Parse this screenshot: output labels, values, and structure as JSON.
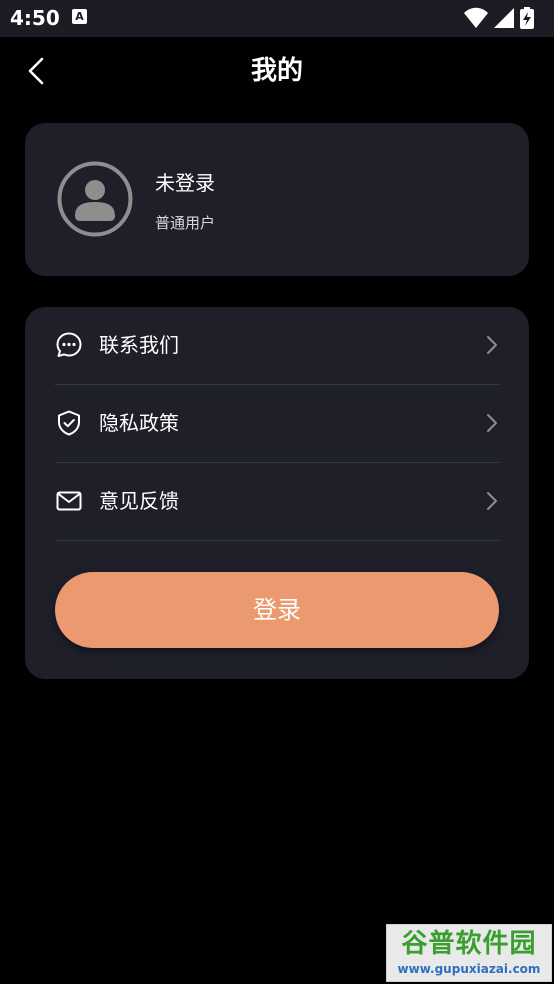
{
  "status_bar": {
    "time": "4:50",
    "a_icon_letter": "A",
    "icons": [
      "wifi-icon",
      "signal-icon",
      "battery-icon"
    ]
  },
  "header": {
    "title": "我的",
    "back_icon": "chevron-left-icon"
  },
  "profile": {
    "name": "未登录",
    "role": "普通用户",
    "avatar_icon": "user-avatar-icon"
  },
  "menu": {
    "items": [
      {
        "label": "联系我们",
        "icon": "chat-bubble-icon"
      },
      {
        "label": "隐私政策",
        "icon": "shield-check-icon"
      },
      {
        "label": "意见反馈",
        "icon": "mail-icon"
      }
    ]
  },
  "login": {
    "label": "登录"
  },
  "watermark": {
    "title": "谷普软件园",
    "url": "www.gupuxiazai.com"
  },
  "colors": {
    "background": "#000000",
    "card": "#1e1f29",
    "status_bar": "#1c1d24",
    "accent": "#eb996e",
    "divider": "#363845"
  }
}
